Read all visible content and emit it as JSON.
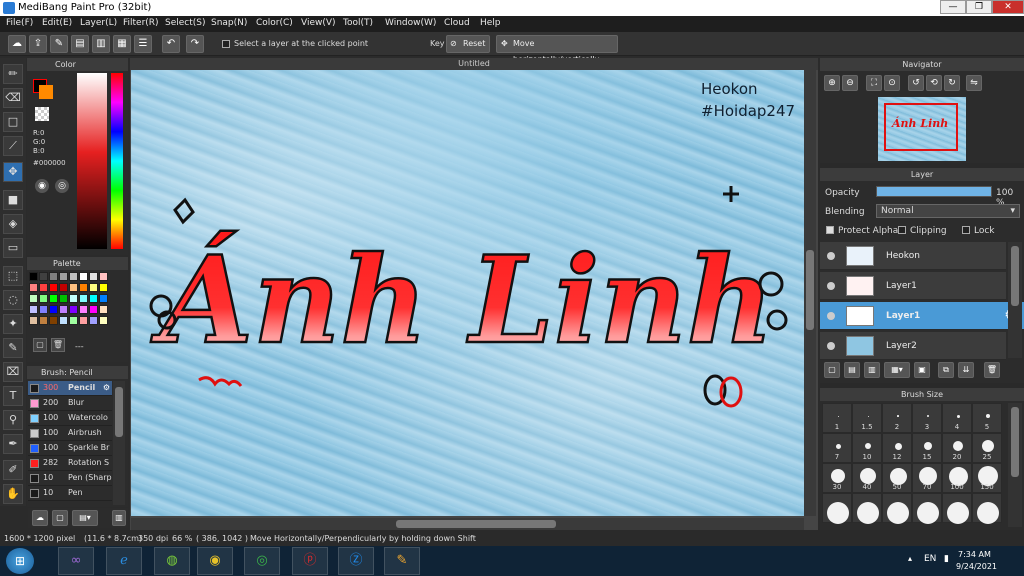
{
  "app": {
    "title": "MediBang Paint Pro (32bit)"
  },
  "window_buttons": [
    "—",
    "❐",
    "✕"
  ],
  "menu": [
    "File(F)",
    "Edit(E)",
    "Layer(L)",
    "Filter(R)",
    "Select(S)",
    "Snap(N)",
    "Color(C)",
    "View(V)",
    "Tool(T)",
    "Window(W)",
    "Cloud",
    "Help"
  ],
  "toolbar": {
    "select_layer_label": "Select a layer at the clicked point",
    "key_label": "Key",
    "reset_label": "Reset",
    "move_label": "Move horizontally/vertically"
  },
  "color_panel": {
    "title": "Color",
    "r": "R:0",
    "g": "G:0",
    "b": "B:0",
    "hex": "#000000"
  },
  "palette_panel": {
    "title": "Palette",
    "dash": "---",
    "colors": [
      "#000000",
      "#404040",
      "#808080",
      "#a0a0a0",
      "#c0c0c0",
      "#ffffff",
      "#e0e0e0",
      "#ffc0c0",
      "#ff8080",
      "#ff4040",
      "#ff0000",
      "#c00000",
      "#ffc080",
      "#ff8000",
      "#ffff80",
      "#ffff00",
      "#c0ffc0",
      "#80ff80",
      "#00ff00",
      "#00c000",
      "#c0ffff",
      "#80ffff",
      "#00ffff",
      "#0080ff",
      "#c0c0ff",
      "#8080ff",
      "#0000ff",
      "#c080ff",
      "#8000ff",
      "#ff80ff",
      "#ff00ff",
      "#ffe0c0",
      "#e0c0a0",
      "#c08040",
      "#804000",
      "#c0e0ff",
      "#a0ffa0",
      "#ffa0a0",
      "#a0a0ff",
      "#ffffc0"
    ]
  },
  "brush_panel": {
    "title": "Brush: Pencil",
    "items": [
      {
        "size": "300",
        "name": "Pencil",
        "color": "#1a1a1a"
      },
      {
        "size": "200",
        "name": "Blur",
        "color": "#ff9ad0"
      },
      {
        "size": "100",
        "name": "Watercolo",
        "color": "#80d0ff"
      },
      {
        "size": "100",
        "name": "Airbrush",
        "color": "#cccccc"
      },
      {
        "size": "100",
        "name": "Sparkle Br",
        "color": "#2060ff"
      },
      {
        "size": "282",
        "name": "Rotation S",
        "color": "#ff2020"
      },
      {
        "size": "10",
        "name": "Pen (Sharp",
        "color": "#1a1a1a"
      },
      {
        "size": "10",
        "name": "Pen",
        "color": "#1a1a1a"
      }
    ]
  },
  "canvas": {
    "tab": "Untitled",
    "watermark_line1": "Heokon",
    "watermark_line2": "#Hoidap247",
    "artwork_text": "Ánh Linh"
  },
  "navigator": {
    "title": "Navigator"
  },
  "layer_panel": {
    "title": "Layer",
    "opacity_label": "Opacity",
    "opacity_value": "100 %",
    "opacity_fraction": 1.0,
    "blending_label": "Blending",
    "blending_value": "Normal",
    "protect_alpha": "Protect Alpha",
    "clipping": "Clipping",
    "lock": "Lock",
    "layers": [
      "Heokon",
      "Layer1",
      "Layer1",
      "Layer2"
    ]
  },
  "brush_size_panel": {
    "title": "Brush Size",
    "sizes": [
      "1",
      "1.5",
      "2",
      "3",
      "4",
      "5",
      "7",
      "10",
      "12",
      "15",
      "20",
      "25",
      "30",
      "40",
      "50",
      "70",
      "100",
      "150"
    ]
  },
  "status": {
    "dimensions": "1600 * 1200 pixel",
    "physical": "(11.6 * 8.7cm)",
    "dpi": "350 dpi",
    "zoom": "66 %",
    "coords": "( 386, 1042 )",
    "hint": "Move Horizontally/Perpendicularly by holding down Shift"
  },
  "taskbar": {
    "lang": "EN",
    "time": "7:34 AM",
    "date": "9/24/2021"
  }
}
